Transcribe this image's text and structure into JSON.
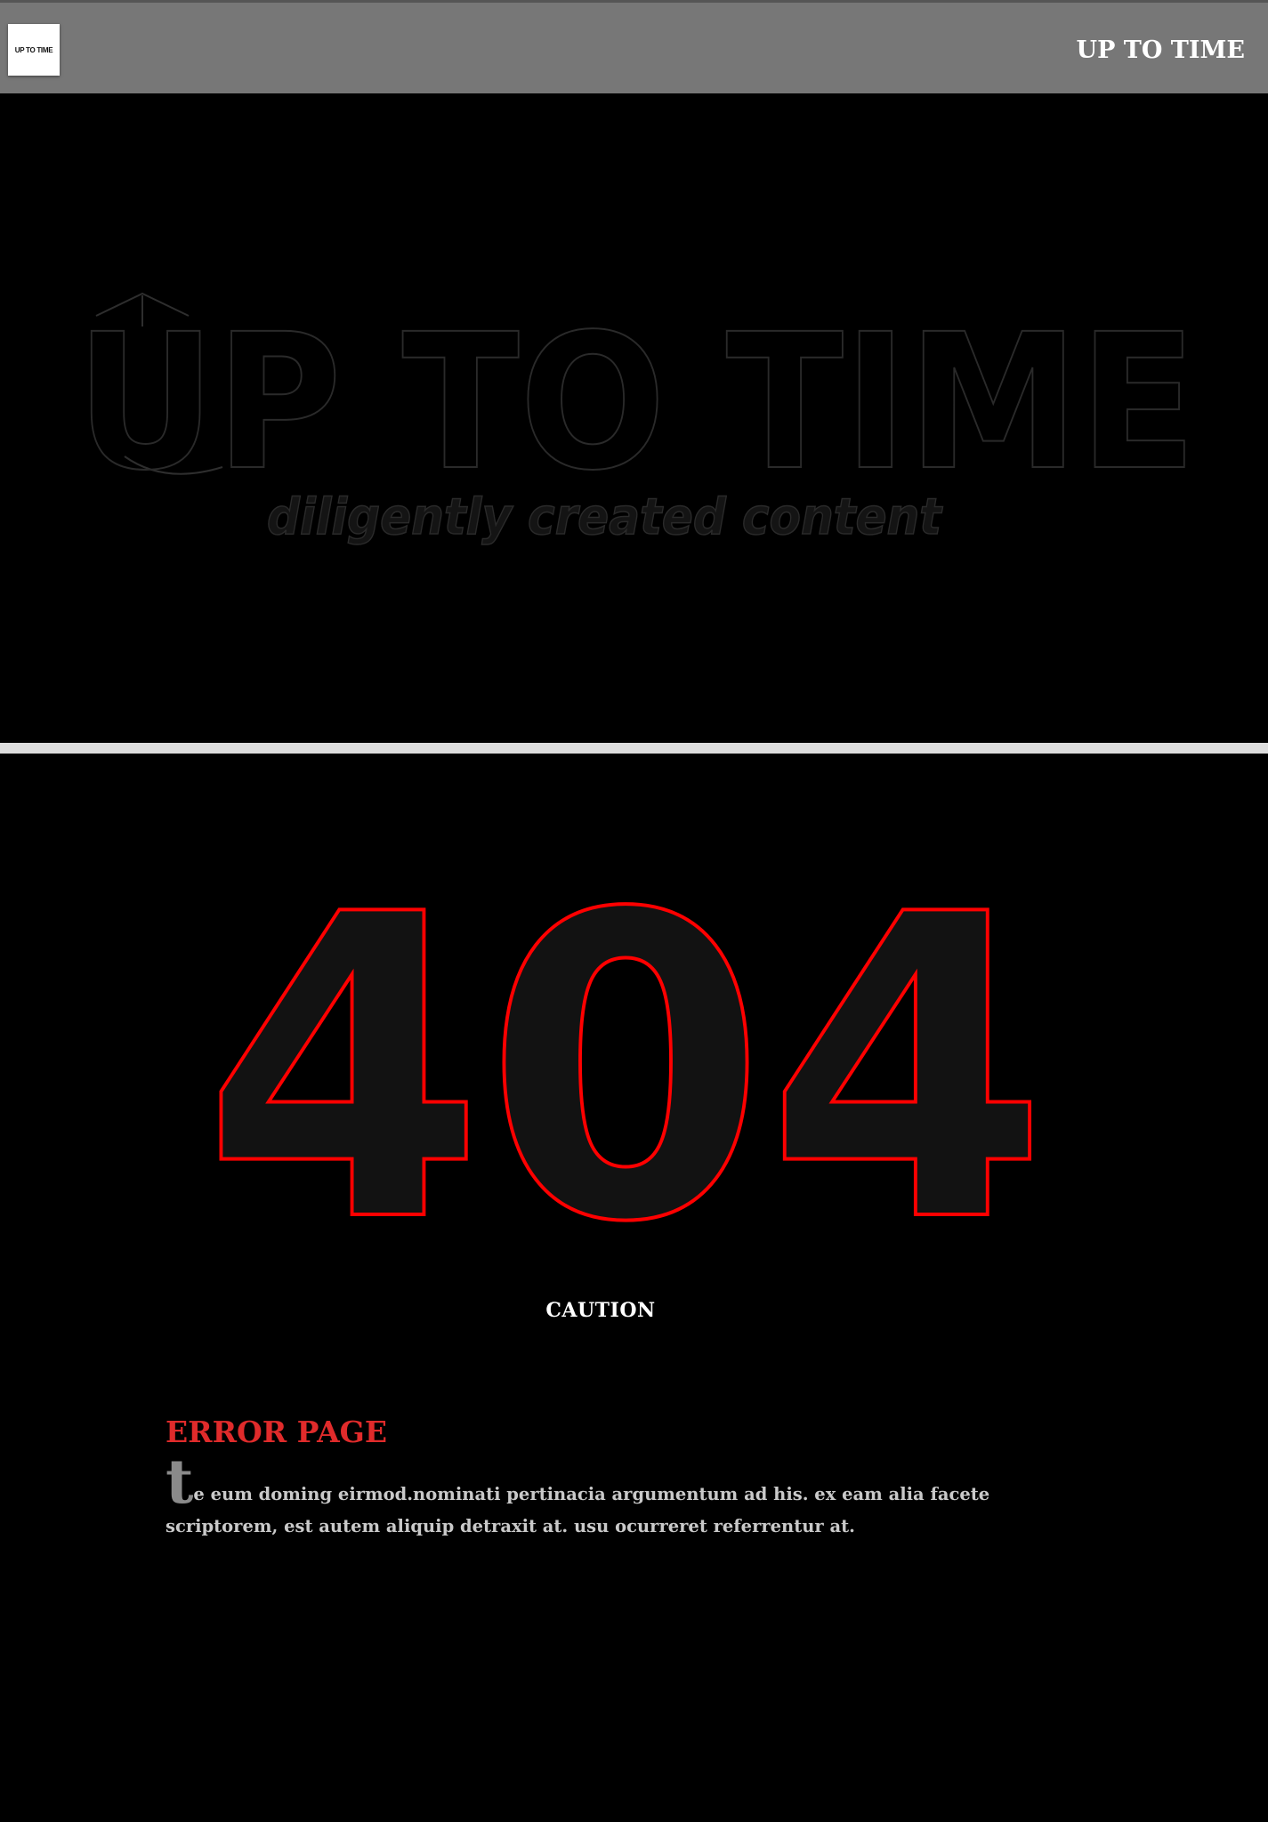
{
  "header": {
    "logo_text": "UP TO TIME",
    "title": "UP TO TIME"
  },
  "hero": {
    "brand_text": "UP TO TIME",
    "tagline": "diligently created content"
  },
  "error": {
    "code": "404",
    "caution": "CAUTION",
    "heading": "ERROR PAGE",
    "drop_cap": "t",
    "body": "e eum doming eirmod.nominati pertinacia argumentum ad his. ex eam alia facete scriptorem, est autem aliquip detraxit at. usu ocurreret referrentur at."
  },
  "colors": {
    "header_bg": "#777777",
    "accent_red": "#e02b2b",
    "outline_red": "#ff0000",
    "background": "#000000",
    "divider": "#dddddd"
  }
}
